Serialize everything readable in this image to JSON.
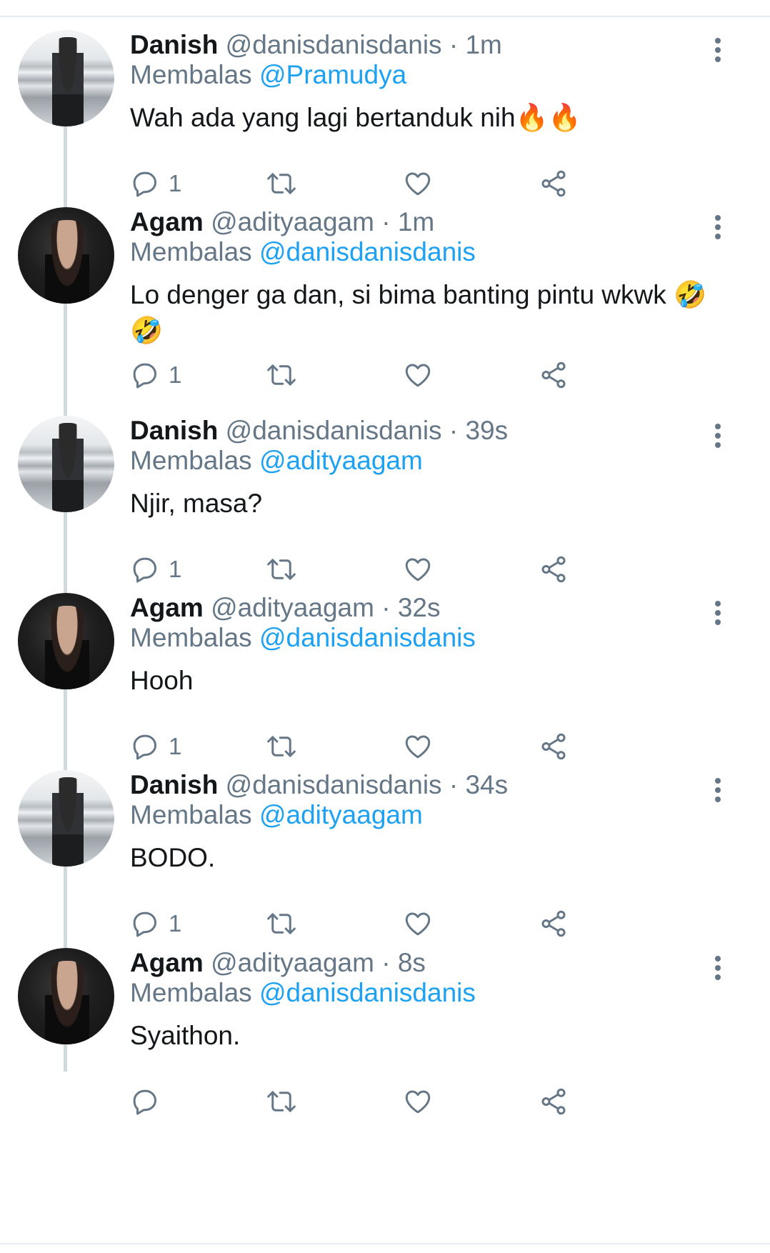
{
  "theme": {
    "mention_color": "#1da1f2",
    "muted_color": "#657786",
    "text_color": "#14171a",
    "thread_line_color": "#cfd9de"
  },
  "reply_prefix": "Membalas",
  "tweets": [
    {
      "name": "Danish",
      "handle": "@danisdanisdanis",
      "separator": "·",
      "time": "1m",
      "reply_to": "@Pramudya",
      "text": "Wah ada yang lagi bertanduk nih🔥🔥",
      "reply_count": "1",
      "avatar": "danish"
    },
    {
      "name": "Agam",
      "handle": "@adityaagam",
      "separator": "·",
      "time": "1m",
      "reply_to": "@danisdanisdanis",
      "text": "Lo denger ga dan, si bima banting pintu wkwk 🤣🤣",
      "reply_count": "1",
      "avatar": "agam"
    },
    {
      "name": "Danish",
      "handle": "@danisdanisdanis",
      "separator": "·",
      "time": "39s",
      "reply_to": "@adityaagam",
      "text": "Njir, masa?",
      "reply_count": "1",
      "avatar": "danish"
    },
    {
      "name": "Agam",
      "handle": "@adityaagam",
      "separator": "·",
      "time": "32s",
      "reply_to": "@danisdanisdanis",
      "text": "Hooh",
      "reply_count": "1",
      "avatar": "agam"
    },
    {
      "name": "Danish",
      "handle": "@danisdanisdanis",
      "separator": "·",
      "time": "34s",
      "reply_to": "@adityaagam",
      "text": "BODO.",
      "reply_count": "1",
      "avatar": "danish"
    },
    {
      "name": "Agam",
      "handle": "@adityaagam",
      "separator": "·",
      "time": "8s",
      "reply_to": "@danisdanisdanis",
      "text": "Syaithon.",
      "reply_count": "",
      "avatar": "agam"
    }
  ]
}
